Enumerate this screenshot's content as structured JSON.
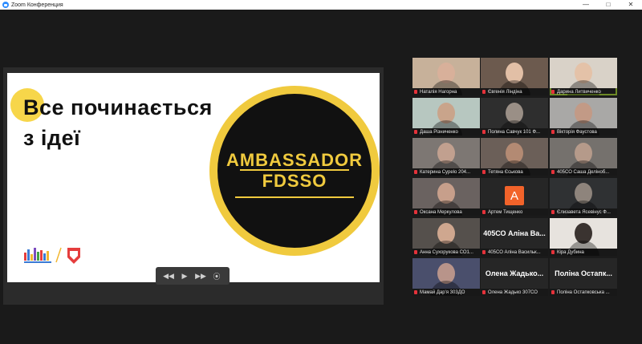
{
  "window": {
    "title": "Zoom Конференция",
    "minimize": "—",
    "maximize": "□",
    "close": "✕"
  },
  "slide": {
    "heading_line1": "Все починається",
    "heading_line2": "з ідеї",
    "badge_line1": "AMBASSADOR",
    "badge_line2": "FDSSO"
  },
  "controls": {
    "rewind": "◀◀",
    "play": "▶",
    "forward": "▶▶",
    "stop": "⦿"
  },
  "participants": [
    {
      "name": "Наталія Нагорна",
      "type": "video",
      "scene": "#c7b19a",
      "face": "#d8b09a"
    },
    {
      "name": "Євгенія Ліндіна",
      "type": "video",
      "scene": "#6c5a4e",
      "face": "#e2bfa6"
    },
    {
      "name": "Дарина Литвиченко",
      "type": "video",
      "scene": "#d9d2c8",
      "face": "#e4c2a8",
      "active": true
    },
    {
      "name": "Даша Різниченко",
      "type": "video",
      "scene": "#b7c7c0",
      "face": "#c9a48b"
    },
    {
      "name": "Полина Савчук 101 Ф...",
      "type": "video",
      "scene": "#2e2e2e",
      "face": "#9a8f86"
    },
    {
      "name": "Вікторія Фаустова",
      "type": "video",
      "scene": "#a9a8a6",
      "face": "#c29a86"
    },
    {
      "name": "Катерина Суреlo 204...",
      "type": "video",
      "scene": "#7d7773",
      "face": "#c1a08f"
    },
    {
      "name": "Тетяна Єськова",
      "type": "video",
      "scene": "#6b5f58",
      "face": "#b38a73"
    },
    {
      "name": "405СО Саша Деліноб...",
      "type": "video",
      "scene": "#75716d",
      "face": "#b59a8a"
    },
    {
      "name": "Оксана Меркулова",
      "type": "video",
      "scene": "#6a6260",
      "face": "#c79f8b"
    },
    {
      "name": "Артем Тищенко",
      "type": "avatar",
      "initial": "A"
    },
    {
      "name": "Єлизавета Ясевінус Ф...",
      "type": "video",
      "scene": "#2f3133",
      "face": "#8e847c"
    },
    {
      "name": "Анна Сухорукова СО1...",
      "type": "video",
      "scene": "#55504c",
      "face": "#cfa78f"
    },
    {
      "name": "405СО Аліна Васильк...",
      "type": "label",
      "label": "405СО Аліна Ва..."
    },
    {
      "name": "Кіра Дубина",
      "type": "video",
      "scene": "#e7e3de",
      "face": "#3a3330"
    },
    {
      "name": "Мамай Дар'я 303ДО",
      "type": "video",
      "scene": "#4a4f6c",
      "face": "#b8948a"
    },
    {
      "name": "Олена Жадько 307СО",
      "type": "label",
      "label": "Олена Жадько..."
    },
    {
      "name": "Поліна Остапковська ...",
      "type": "label",
      "label": "Поліна Остапк..."
    }
  ]
}
